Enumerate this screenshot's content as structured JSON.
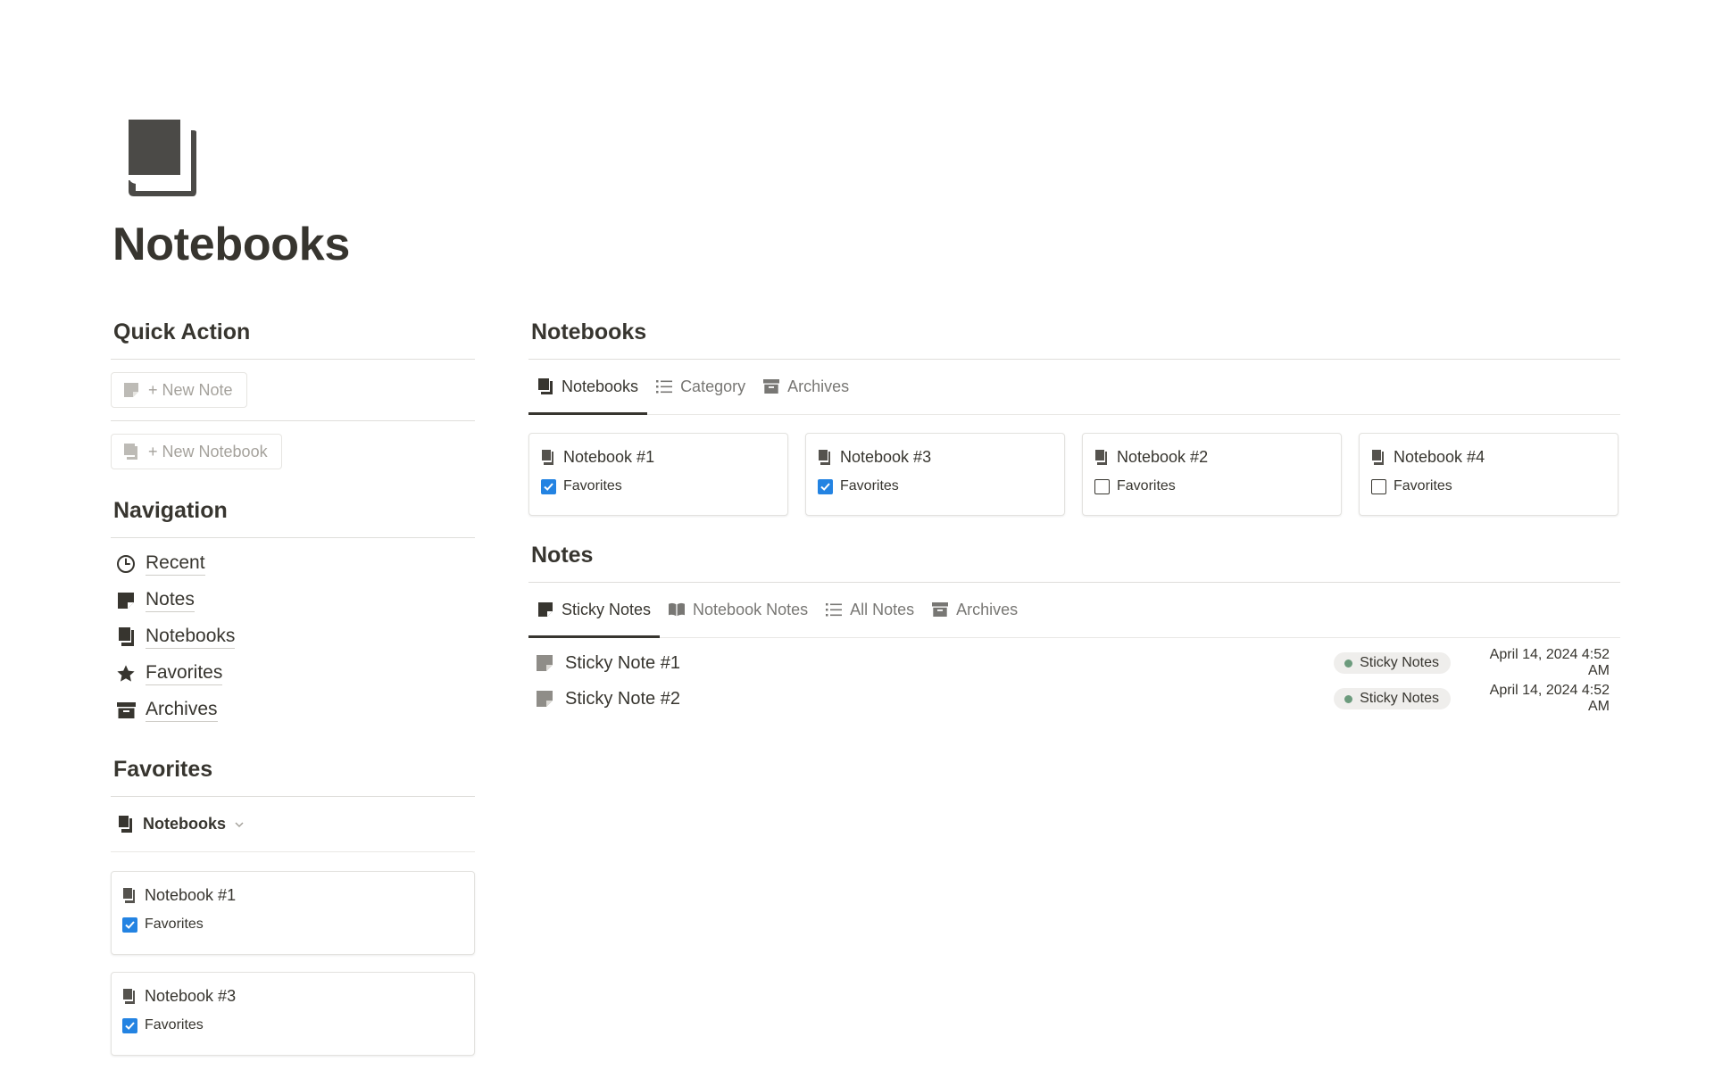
{
  "page": {
    "title": "Notebooks",
    "icon": "notebook-icon"
  },
  "quick_action": {
    "heading": "Quick Action",
    "buttons": [
      {
        "label": "+ New Note",
        "icon": "sticky-note-icon"
      },
      {
        "label": "+ New Notebook",
        "icon": "notebook-icon"
      }
    ]
  },
  "navigation": {
    "heading": "Navigation",
    "items": [
      {
        "label": "Recent",
        "icon": "clock-icon"
      },
      {
        "label": "Notes",
        "icon": "sticky-note-icon"
      },
      {
        "label": "Notebooks",
        "icon": "notebook-icon"
      },
      {
        "label": "Favorites",
        "icon": "star-icon"
      },
      {
        "label": "Archives",
        "icon": "archive-icon"
      }
    ]
  },
  "favorites": {
    "heading": "Favorites",
    "view_label": "Notebooks",
    "cards": [
      {
        "title": "Notebook #1",
        "prop": "Favorites",
        "checked": true
      },
      {
        "title": "Notebook #3",
        "prop": "Favorites",
        "checked": true
      }
    ]
  },
  "notebooks": {
    "heading": "Notebooks",
    "tabs": [
      {
        "label": "Notebooks",
        "icon": "notebook-icon",
        "active": true
      },
      {
        "label": "Category",
        "icon": "list-icon",
        "active": false
      },
      {
        "label": "Archives",
        "icon": "archive-icon",
        "active": false
      }
    ],
    "cards": [
      {
        "title": "Notebook #1",
        "prop": "Favorites",
        "checked": true
      },
      {
        "title": "Notebook #3",
        "prop": "Favorites",
        "checked": true
      },
      {
        "title": "Notebook #2",
        "prop": "Favorites",
        "checked": false
      },
      {
        "title": "Notebook #4",
        "prop": "Favorites",
        "checked": false
      }
    ]
  },
  "notes": {
    "heading": "Notes",
    "tabs": [
      {
        "label": "Sticky Notes",
        "icon": "sticky-note-icon",
        "active": true
      },
      {
        "label": "Notebook Notes",
        "icon": "open-book-icon",
        "active": false
      },
      {
        "label": "All Notes",
        "icon": "list-icon",
        "active": false
      },
      {
        "label": "Archives",
        "icon": "archive-icon",
        "active": false
      }
    ],
    "rows": [
      {
        "title": "Sticky Note #1",
        "tag": "Sticky Notes",
        "date": "April 14, 2024 4:52 AM"
      },
      {
        "title": "Sticky Note #2",
        "tag": "Sticky Notes",
        "date": "April 14, 2024 4:52 AM"
      }
    ]
  },
  "colors": {
    "text": "#37352f",
    "muted": "#787774",
    "checkbox": "#2383e2",
    "tag_dot": "#6c9b7d",
    "tag_bg": "#efeeec"
  }
}
